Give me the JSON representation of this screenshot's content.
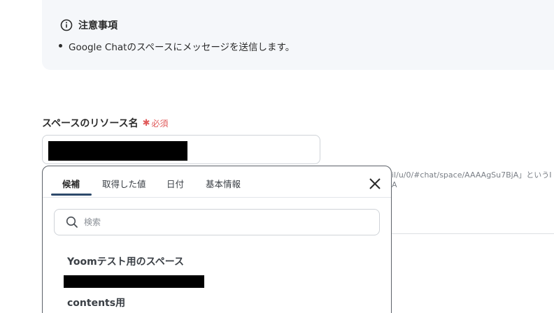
{
  "notice": {
    "title": "注意事項",
    "items": [
      "Google Chatのスペースにメッセージを送信します。"
    ]
  },
  "field": {
    "label": "スペースのリソース名",
    "required_label": "必須",
    "value": ""
  },
  "hint": {
    "line1": "il/u/0/#chat/space/AAAAgSu7BjA」というI",
    "line2": "A"
  },
  "popup": {
    "tabs": [
      "候補",
      "取得した値",
      "日付",
      "基本情報"
    ],
    "active_tab": "候補",
    "search_placeholder": "検索",
    "options": [
      {
        "label": "Yoomテスト用のスペース",
        "sub": "・・・・ ・・・ ・・・・・・ ・・・"
      },
      {
        "label": "contents用"
      }
    ]
  },
  "colors": {
    "accent": "#2d4a6b",
    "required": "#e05a5a",
    "notice_bg": "#f5f7fa"
  }
}
